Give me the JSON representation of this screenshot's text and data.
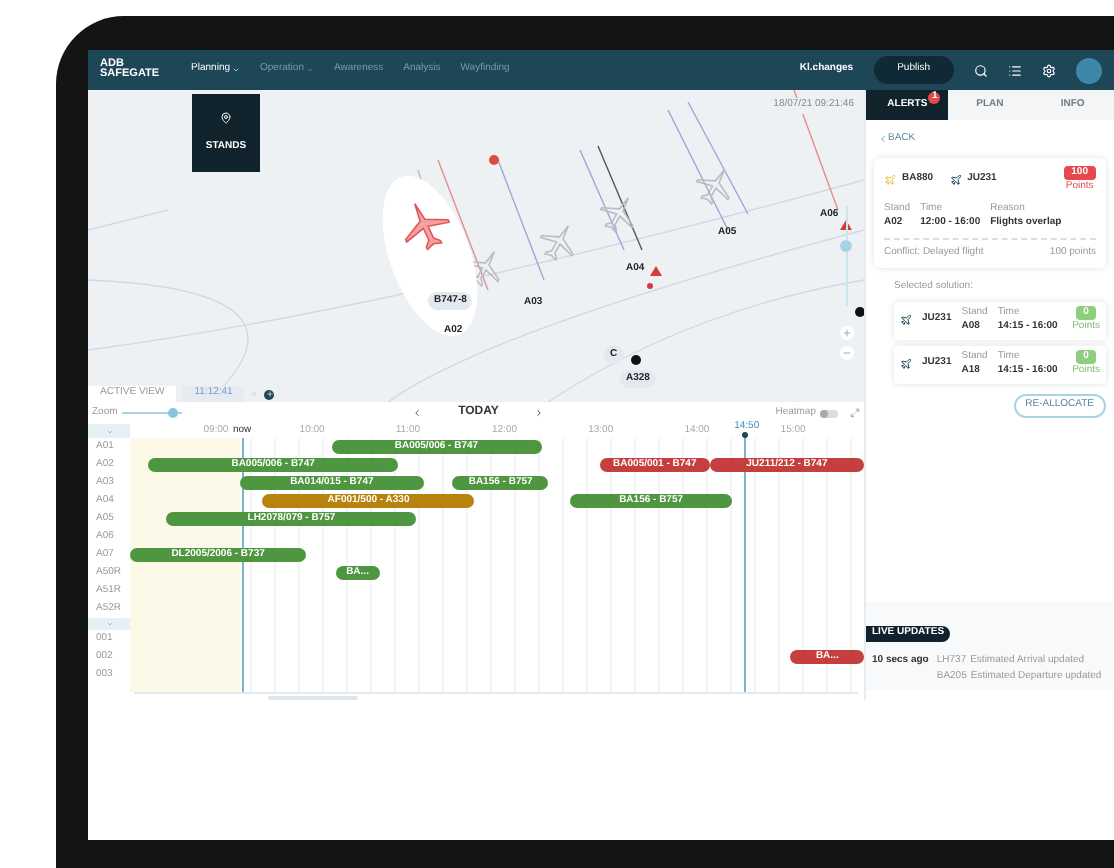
{
  "header": {
    "logo": {
      "line1": "ADB",
      "line2": "SAFEGATE"
    },
    "nav": [
      {
        "label": "Planning",
        "menu": true,
        "selected": true
      },
      {
        "label": "Operation",
        "menu": true,
        "selected": false
      },
      {
        "label": "Awareness",
        "menu": false,
        "selected": false
      },
      {
        "label": "Analysis",
        "menu": false,
        "selected": false
      },
      {
        "label": "Wayfinding",
        "menu": false,
        "selected": false
      }
    ],
    "user": "Kl.changes",
    "publish_button": "Publish"
  },
  "map": {
    "stands_button": "STANDS",
    "timestamp": "18/07/21 09:21:46",
    "labels": [
      {
        "text": "B747-8",
        "kind": "tag"
      },
      {
        "text": "A02",
        "kind": "stand"
      },
      {
        "text": "A03",
        "kind": "stand"
      },
      {
        "text": "A04",
        "kind": "stand"
      },
      {
        "text": "A05",
        "kind": "stand"
      },
      {
        "text": "A06",
        "kind": "stand"
      },
      {
        "text": "C",
        "kind": "tag"
      },
      {
        "text": "A328",
        "kind": "tag"
      }
    ],
    "zoom_slider": {
      "level": 0.6
    },
    "view_tabs": [
      {
        "label": "ACTIVE VIEW",
        "selected": true
      },
      {
        "label": "11:12:41",
        "selected": false
      }
    ]
  },
  "timeline": {
    "zoom_label": "Zoom",
    "zoom": {
      "level": 0.85
    },
    "today": "TODAY",
    "heatmap": {
      "label": "Heatmap",
      "on": false
    },
    "times": [
      "09:00",
      "now",
      "10:00",
      "11:00",
      "12:00",
      "13:00",
      "14:00",
      "15:00"
    ],
    "current_time": "14:50",
    "groups": [
      {
        "expanded": true,
        "rows": [
          {
            "label": "A01",
            "bars": [
              {
                "text": "BA005/006 - B747",
                "kind": "ok"
              }
            ]
          },
          {
            "label": "A02",
            "bars": [
              {
                "text": "BA005/006 - B747",
                "kind": "ok"
              },
              {
                "text": "BA005/001 - B747",
                "kind": "conflict"
              },
              {
                "text": "JU211/212 - B747",
                "kind": "conflict"
              }
            ]
          },
          {
            "label": "A03",
            "bars": [
              {
                "text": "BA014/015 - B747",
                "kind": "ok"
              },
              {
                "text": "BA156 - B757",
                "kind": "ok"
              }
            ]
          },
          {
            "label": "A04",
            "bars": [
              {
                "text": "AF001/500 - A330",
                "kind": "warning"
              },
              {
                "text": "BA156 - B757",
                "kind": "ok"
              }
            ]
          },
          {
            "label": "A05",
            "bars": [
              {
                "text": "LH2078/079 - B757",
                "kind": "ok"
              }
            ]
          },
          {
            "label": "A06",
            "bars": []
          },
          {
            "label": "A07",
            "bars": [
              {
                "text": "DL2005/2006 - B737",
                "kind": "ok"
              }
            ]
          },
          {
            "label": "A50R",
            "bars": [
              {
                "text": "BA...",
                "kind": "ok"
              }
            ]
          },
          {
            "label": "A51R",
            "bars": []
          },
          {
            "label": "A52R",
            "bars": []
          }
        ]
      },
      {
        "expanded": true,
        "rows": [
          {
            "label": "001",
            "bars": []
          },
          {
            "label": "002",
            "bars": [
              {
                "text": "BA...",
                "kind": "conflict"
              }
            ]
          },
          {
            "label": "003",
            "bars": []
          }
        ]
      }
    ]
  },
  "panel": {
    "tabs": [
      {
        "label": "ALERTS",
        "badge": "1",
        "selected": true
      },
      {
        "label": "PLAN",
        "selected": false
      },
      {
        "label": "INFO",
        "selected": false
      }
    ],
    "back": "BACK",
    "alert": {
      "flights": [
        {
          "code": "BA880",
          "kind": "arrival"
        },
        {
          "code": "JU231",
          "kind": "departure"
        }
      ],
      "score": "100",
      "score_label": "Points",
      "kind": "conflict",
      "fields": [
        {
          "label": "Stand",
          "value": "A02"
        },
        {
          "label": "Time",
          "value": "12:00 - 16:00"
        },
        {
          "label": "Reason",
          "value": "Flights overlap"
        }
      ],
      "conflict": "Conflict: Delayed flight",
      "conflict_points": "100 points"
    },
    "solution_title": "Selected solution:",
    "solutions": [
      {
        "flight": "JU231",
        "fields": [
          {
            "label": "Stand",
            "value": "A08"
          },
          {
            "label": "Time",
            "value": "14:15 - 16:00"
          }
        ],
        "score": "0",
        "score_label": "Points",
        "kind": "ok"
      },
      {
        "flight": "JU231",
        "fields": [
          {
            "label": "Stand",
            "value": "A18"
          },
          {
            "label": "Time",
            "value": "14:15 - 16:00"
          }
        ],
        "score": "0",
        "score_label": "Points",
        "kind": "ok"
      }
    ],
    "reallocate": "RE-ALLOCATE",
    "live": {
      "title": "LIVE UPDATES",
      "age": "10 secs ago",
      "updates": [
        {
          "flight": "LH737",
          "text": "Estimated Arrival updated"
        },
        {
          "flight": "BA205",
          "text": "Estimated Departure updated"
        }
      ]
    }
  }
}
